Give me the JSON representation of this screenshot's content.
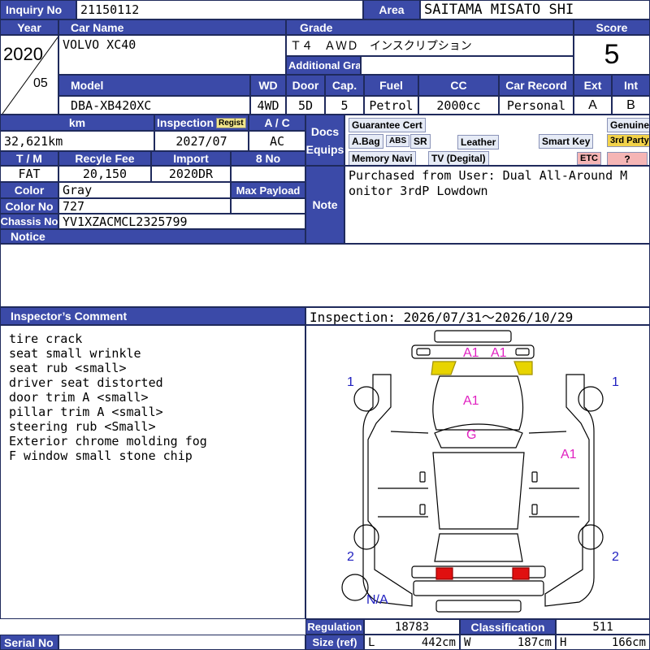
{
  "labels": {
    "inquiry_no": "Inquiry No",
    "area": "Area",
    "year": "Year",
    "car_name": "Car Name",
    "grade": "Grade",
    "score": "Score",
    "additional_grade": "Additional Grade",
    "model": "Model",
    "wd": "WD",
    "door": "Door",
    "cap": "Cap.",
    "fuel": "Fuel",
    "cc": "CC",
    "car_record": "Car Record",
    "ext": "Ext",
    "int": "Int",
    "km": "km",
    "inspection": "Inspection",
    "regist": "Regist",
    "ac": "A / C",
    "docs": "Docs",
    "equips": "Equips",
    "tm": "T / M",
    "recycle_fee": "Recyle Fee",
    "import": "Import",
    "eight_no": "8 No",
    "color": "Color",
    "max_payload": "Max Payload",
    "note": "Note",
    "color_no": "Color No",
    "chassis_no": "Chassis No",
    "notice": "Notice",
    "inspectors_comment": "Inspector’s Comment",
    "regulation": "Regulation",
    "classification": "Classification",
    "size_ref": "Size (ref)",
    "serial_no": "Serial No",
    "l": "L",
    "w": "W",
    "h": "H"
  },
  "vehicle": {
    "inquiry_no": "21150112",
    "area": "SAITAMA MISATO SHI",
    "year": "2020",
    "month": "05",
    "car_name": "VOLVO XC40",
    "grade": "Ｔ４　ＡＷＤ　インスクリプション",
    "additional_grade": "",
    "score": "5",
    "model": "DBA-XB420XC",
    "wd": "4WD",
    "door": "5D",
    "cap": "5",
    "fuel": "Petrol",
    "cc": "2000cc",
    "car_record": "Personal",
    "ext": "A",
    "int": "B",
    "km": "32,621km",
    "inspection": "2027/07",
    "ac": "AC",
    "tm": "FAT",
    "recycle_fee": "20,150",
    "import": "2020DR",
    "eight_no": "",
    "color": "Gray",
    "max_payload": "",
    "color_no": "727",
    "chassis_no": "YV1XZACMCL2325799",
    "note": "Purchased from User: Dual All-Around M\nonitor 3rdP Lowdown",
    "notice": "",
    "serial_no": ""
  },
  "equips": {
    "guarantee_cert": "Guarantee Cert",
    "genuine": "Genuine",
    "abag": "A.Bag",
    "abs": "ABS",
    "sr": "SR",
    "leather": "Leather",
    "smart_key": "Smart Key",
    "third_party": "3rd Party",
    "memory_navi": "Memory Navi",
    "tv": "TV (Degital)",
    "etc": "ETC",
    "question": "?"
  },
  "inspection_period": "Inspection: 2026/07/31～2026/10/29",
  "comments": [
    "tire crack",
    "seat small wrinkle",
    "seat rub <small>",
    "driver seat distorted",
    "door trim A <small>",
    "pillar trim A <small>",
    "steering rub <Small>",
    "Exterior chrome molding fog",
    "F window small stone chip"
  ],
  "diagram_marks": {
    "front_a1_left": "A1",
    "front_a1_right": "A1",
    "hood": "A1",
    "windshield": "G",
    "right_side": "A1",
    "tire_fl": "1",
    "tire_fr": "1",
    "tire_rl": "2",
    "tire_rr": "2",
    "spare": "N/A"
  },
  "regulation": "18783",
  "classification": "511",
  "size": {
    "l": "442cm",
    "w": "187cm",
    "h": "166cm"
  },
  "colors": {
    "header_blue": "#3b4aa8",
    "mark_magenta": "#e020c0",
    "mark_blue": "#2020c0",
    "light_yellow": "#e8d400",
    "tail_red": "#e01010"
  }
}
